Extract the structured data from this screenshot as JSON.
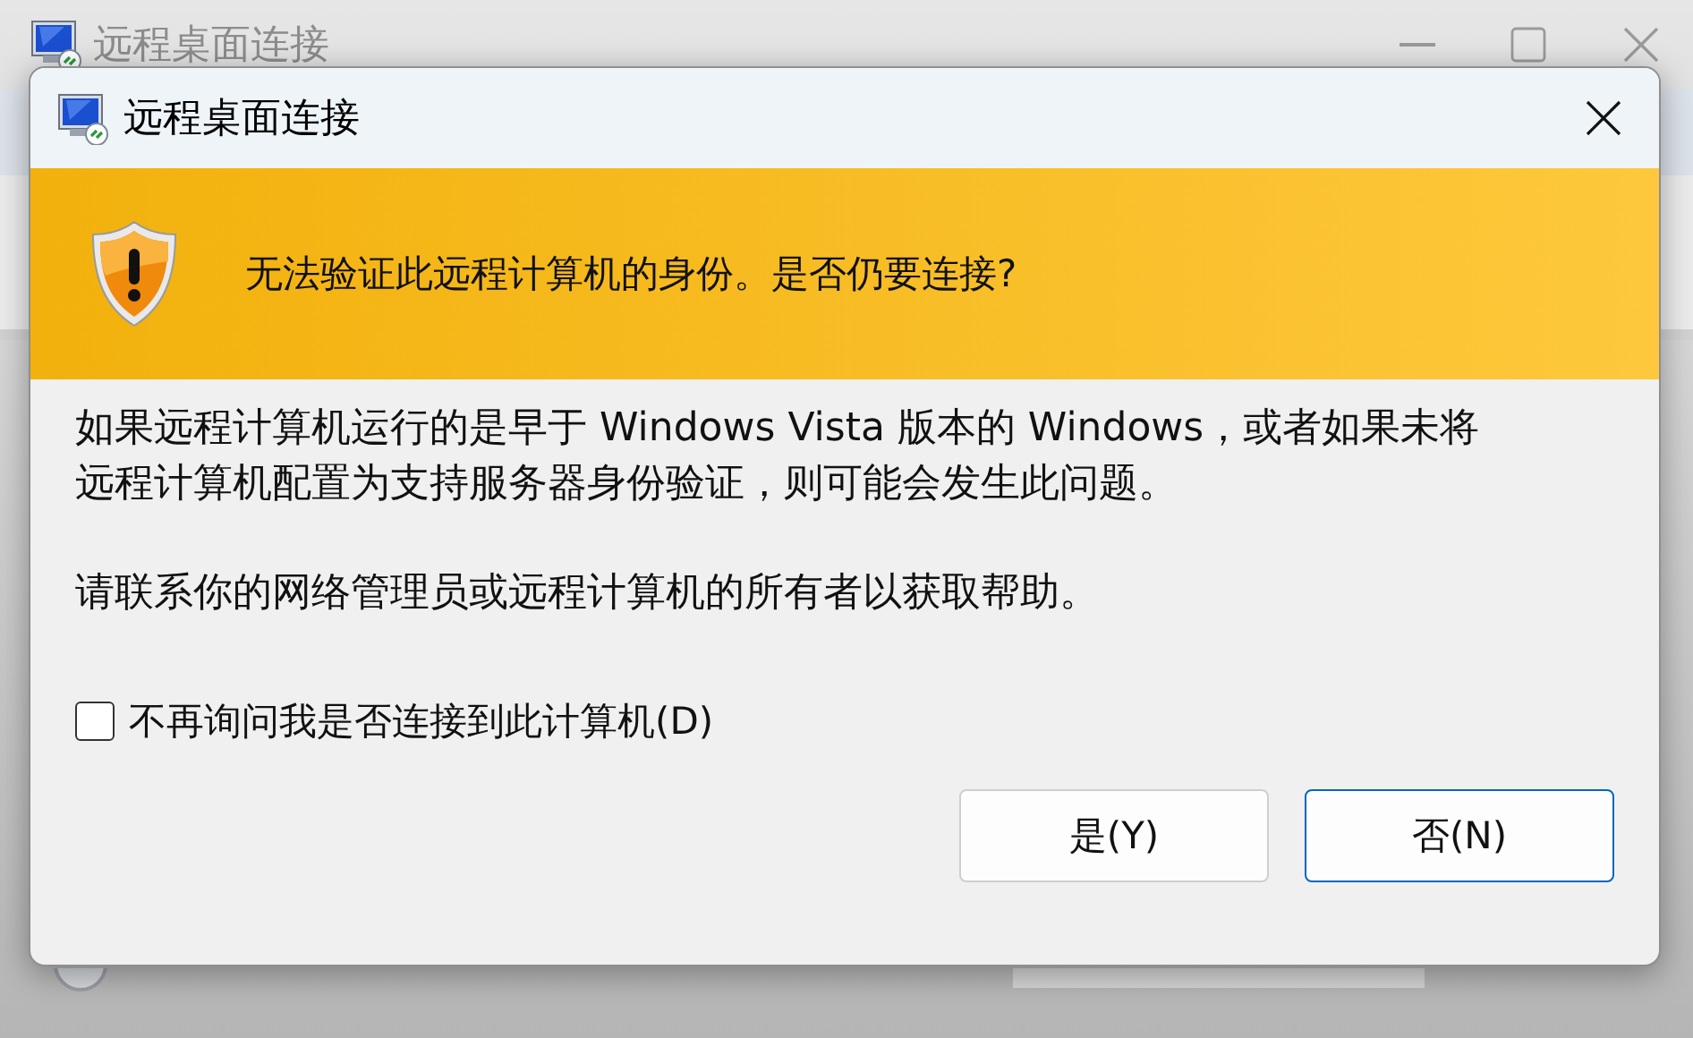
{
  "background_window": {
    "title": "远程桌面连接"
  },
  "dialog": {
    "title": "远程桌面连接",
    "warning": "无法验证此远程计算机的身份。是否仍要连接?",
    "paragraphs": [
      "如果远程计算机运行的是早于 Windows Vista 版本的 Windows，或者如果未将远程计算机配置为支持服务器身份验证，则可能会发生此问题。",
      "请联系你的网络管理员或远程计算机的所有者以获取帮助。"
    ],
    "checkbox": {
      "label": "不再询问我是否连接到此计算机(D)",
      "checked": false
    },
    "buttons": [
      {
        "label": "是(Y)",
        "default": false
      },
      {
        "label": "否(N)",
        "default": true
      }
    ]
  }
}
